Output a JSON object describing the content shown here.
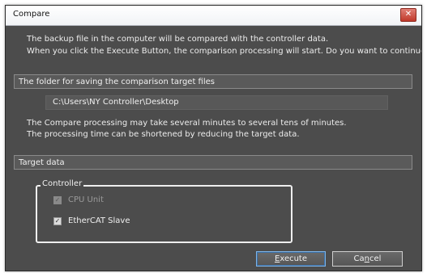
{
  "window": {
    "title": "Compare",
    "close_glyph": "✕"
  },
  "intro": {
    "line1": "The backup file in the computer will be compared with the controller data.",
    "line2": "When you click the Execute Button, the comparison processing will start. Do you want to continue?"
  },
  "folder_section": {
    "header": "The folder for saving the comparison target files",
    "path": "C:\\Users\\NY Controller\\Desktop"
  },
  "note": {
    "line1": "The Compare processing may take several minutes to several tens of minutes.",
    "line2": "The processing time can be shortened by reducing the target data."
  },
  "target_section": {
    "header": "Target data",
    "group_label": "Controller",
    "items": [
      {
        "label": "CPU Unit",
        "checked": true,
        "enabled": false
      },
      {
        "label": "EtherCAT Slave",
        "checked": true,
        "enabled": true
      }
    ]
  },
  "buttons": {
    "execute": {
      "mnemonic": "E",
      "rest": "xecute"
    },
    "cancel": {
      "pre": "Ca",
      "mnemonic": "n",
      "rest": "cel"
    }
  }
}
